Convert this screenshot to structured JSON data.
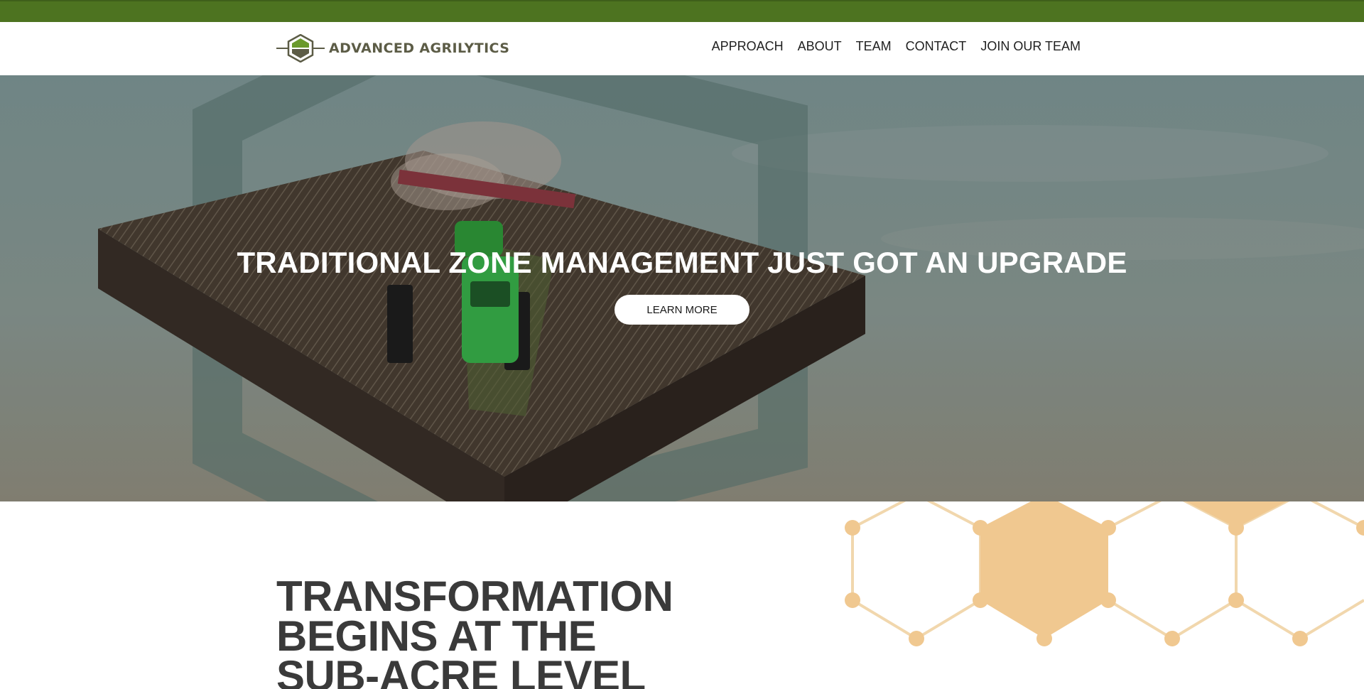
{
  "brand": {
    "name": "ADVANCED AGRILYTICS",
    "colors": {
      "topbar": "#4d7320",
      "logo_green": "#6a9a2c",
      "logo_text": "#5c5c46",
      "honeycomb": "#f0c890"
    }
  },
  "nav": {
    "items": [
      "APPROACH",
      "ABOUT",
      "TEAM",
      "CONTACT",
      "JOIN OUR TEAM"
    ]
  },
  "hero": {
    "title": "TRADITIONAL ZONE MANAGEMENT JUST GOT AN UPGRADE",
    "button_label": "LEARN MORE",
    "image": "tractor-on-soil-block"
  },
  "section": {
    "heading_lines": [
      "TRANSFORMATION",
      "BEGINS AT THE",
      "SUB-ACRE LEVEL"
    ]
  }
}
